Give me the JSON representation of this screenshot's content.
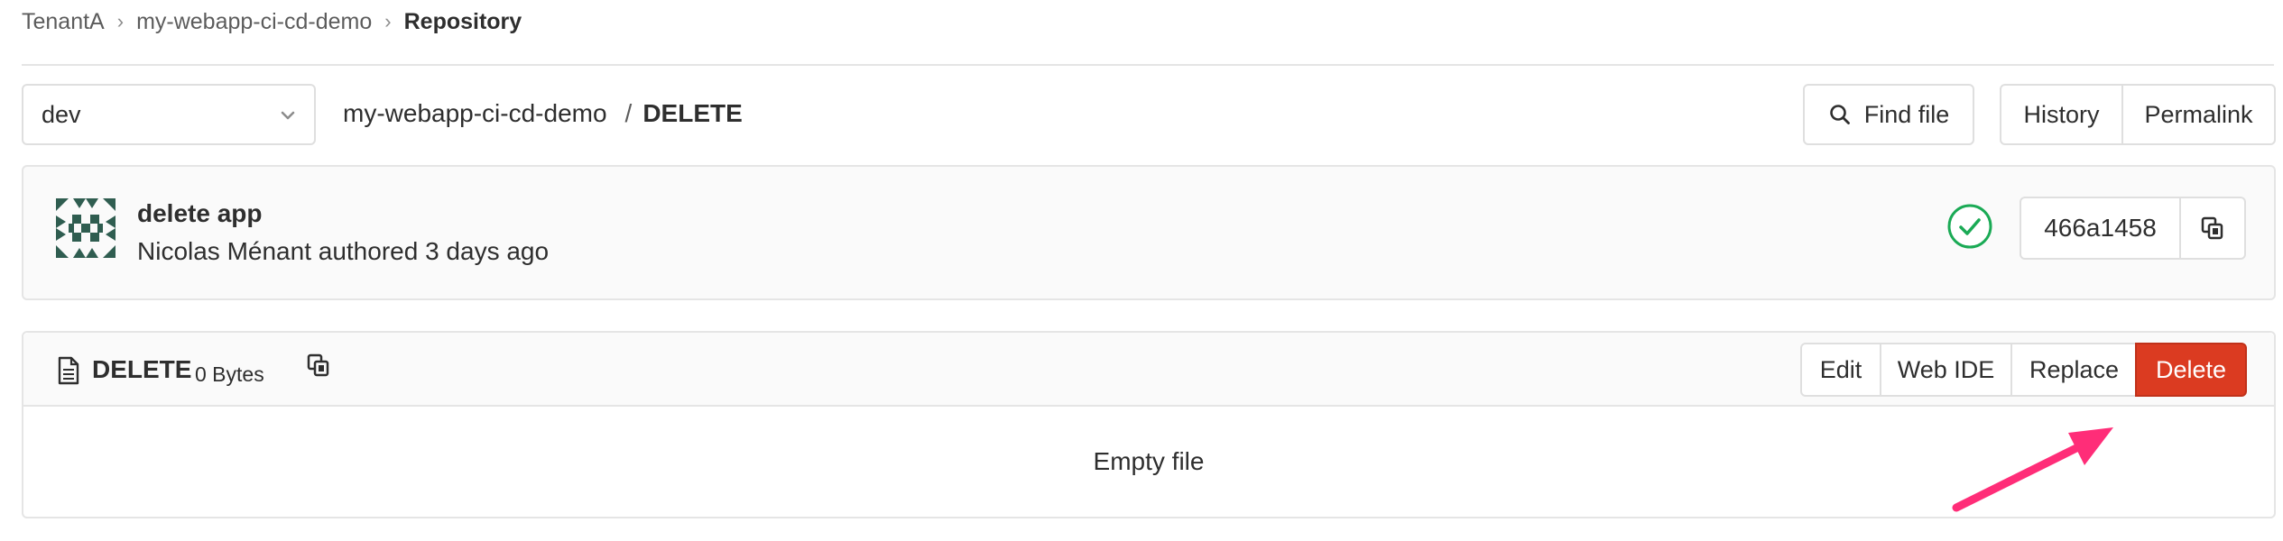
{
  "breadcrumb": {
    "items": [
      "TenantA",
      "my-webapp-ci-cd-demo"
    ],
    "current": "Repository",
    "separator": "›"
  },
  "tree_header": {
    "branch": "dev",
    "path_root": "my-webapp-ci-cd-demo",
    "path_separator": "/",
    "path_current": "DELETE",
    "find_file_label": "Find file",
    "history_label": "History",
    "permalink_label": "Permalink"
  },
  "commit": {
    "title": "delete app",
    "author_line": "Nicolas Ménant authored 3 days ago",
    "sha": "466a1458",
    "pipeline_status": "success",
    "avatar_color": "#2f5d50"
  },
  "file": {
    "name": "DELETE",
    "size": "0 Bytes",
    "buttons": {
      "edit": "Edit",
      "web_ide": "Web IDE",
      "replace": "Replace",
      "delete": "Delete"
    },
    "empty_message": "Empty file"
  },
  "colors": {
    "delete_button": "#db3b21",
    "success": "#1aaa55",
    "annotation_arrow": "#ff2d78"
  }
}
